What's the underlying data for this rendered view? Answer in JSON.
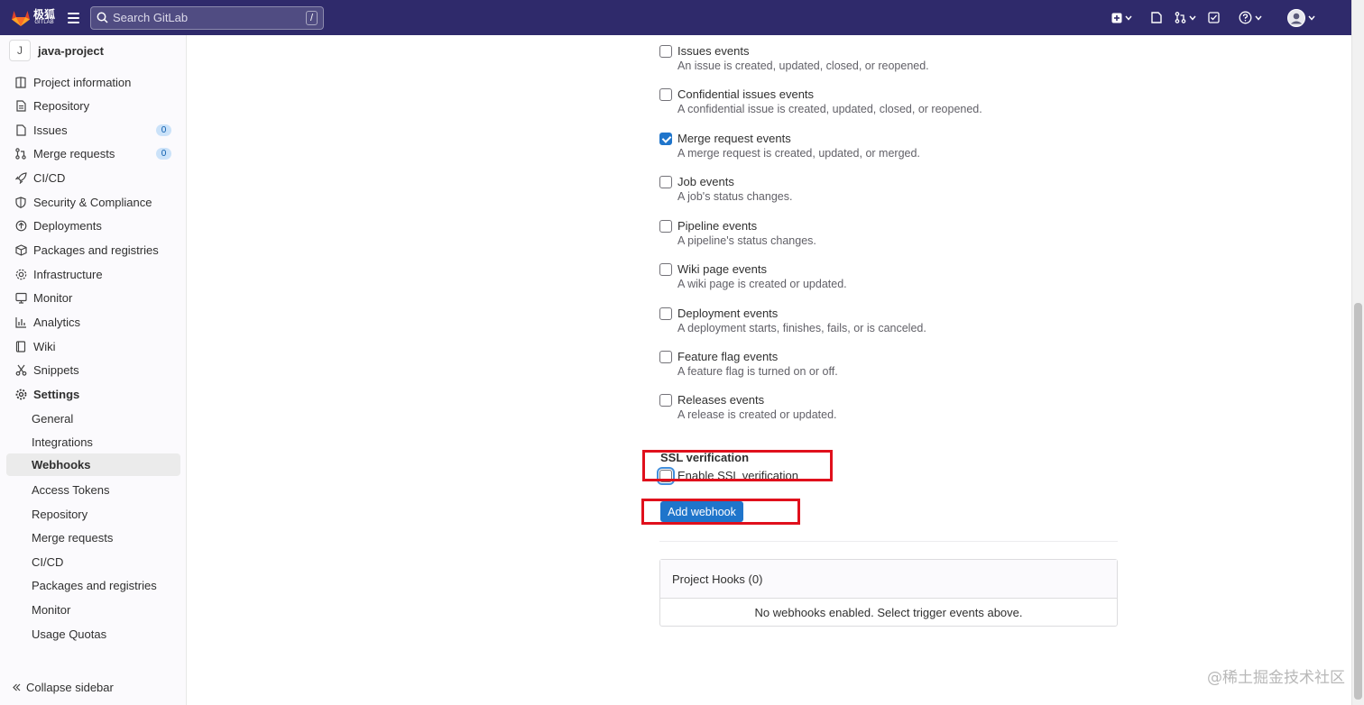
{
  "topbar": {
    "logo_text": "极狐",
    "logo_subtext": "GITLAB",
    "search_placeholder": "Search GitLab",
    "search_shortcut": "/",
    "icons": [
      "plus-square-icon",
      "issues-icon",
      "merge-request-icon",
      "todo-icon",
      "help-icon",
      "user-avatar"
    ]
  },
  "sidebar": {
    "project_initial": "J",
    "project_name": "java-project",
    "items": [
      {
        "label": "Project information",
        "icon": "project-icon"
      },
      {
        "label": "Repository",
        "icon": "doc-text-icon"
      },
      {
        "label": "Issues",
        "icon": "issues-icon",
        "count": "0"
      },
      {
        "label": "Merge requests",
        "icon": "git-merge-icon",
        "count": "0"
      },
      {
        "label": "CI/CD",
        "icon": "rocket-icon"
      },
      {
        "label": "Security & Compliance",
        "icon": "shield-icon"
      },
      {
        "label": "Deployments",
        "icon": "deployments-icon"
      },
      {
        "label": "Packages and registries",
        "icon": "package-icon"
      },
      {
        "label": "Infrastructure",
        "icon": "cloud-gear-icon"
      },
      {
        "label": "Monitor",
        "icon": "monitor-icon"
      },
      {
        "label": "Analytics",
        "icon": "chart-icon"
      },
      {
        "label": "Wiki",
        "icon": "book-icon"
      },
      {
        "label": "Snippets",
        "icon": "scissors-icon"
      },
      {
        "label": "Settings",
        "icon": "settings-icon"
      }
    ],
    "settings_sub": [
      "General",
      "Integrations",
      "Webhooks",
      "Access Tokens",
      "Repository",
      "Merge requests",
      "CI/CD",
      "Packages and registries",
      "Monitor",
      "Usage Quotas"
    ],
    "active_sub": "Webhooks",
    "collapse_label": "Collapse sidebar"
  },
  "events": [
    {
      "label": "Issues events",
      "desc": "An issue is created, updated, closed, or reopened.",
      "checked": false
    },
    {
      "label": "Confidential issues events",
      "desc": "A confidential issue is created, updated, closed, or reopened.",
      "checked": false
    },
    {
      "label": "Merge request events",
      "desc": "A merge request is created, updated, or merged.",
      "checked": true
    },
    {
      "label": "Job events",
      "desc": "A job's status changes.",
      "checked": false
    },
    {
      "label": "Pipeline events",
      "desc": "A pipeline's status changes.",
      "checked": false
    },
    {
      "label": "Wiki page events",
      "desc": "A wiki page is created or updated.",
      "checked": false
    },
    {
      "label": "Deployment events",
      "desc": "A deployment starts, finishes, fails, or is canceled.",
      "checked": false
    },
    {
      "label": "Feature flag events",
      "desc": "A feature flag is turned on or off.",
      "checked": false
    },
    {
      "label": "Releases events",
      "desc": "A release is created or updated.",
      "checked": false
    }
  ],
  "ssl": {
    "title": "SSL verification",
    "label": "Enable SSL verification",
    "checked": false
  },
  "add_button": "Add webhook",
  "hooks": {
    "header": "Project Hooks (0)",
    "empty": "No webhooks enabled. Select trigger events above."
  },
  "watermark": "@稀土掘金技术社区"
}
